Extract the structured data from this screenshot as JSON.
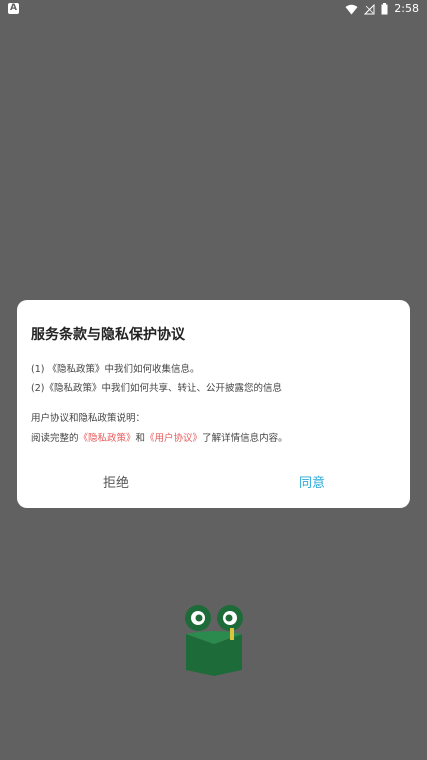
{
  "status_bar": {
    "app_icon_letter": "A",
    "time": "2:58"
  },
  "dialog": {
    "title": "服务条款与隐私保护协议",
    "item1_prefix": "(1) 《隐私政策》中我们如何收集信息。",
    "item2_prefix": "(2)《隐私政策》中我们如何共享、转让、公开披露您的信息",
    "note": "用户协议和隐私政策说明：",
    "read_prefix": "阅读完整的",
    "privacy_link": "《隐私政策》",
    "and_text": "和",
    "user_link": "《用户协议》",
    "read_suffix": "了解详情信息内容。",
    "refuse_label": "拒绝",
    "agree_label": "同意"
  },
  "colors": {
    "overlay": "#616161",
    "link": "#e85a5a",
    "agree": "#29a9d6",
    "logo_green": "#1e6b3a"
  }
}
